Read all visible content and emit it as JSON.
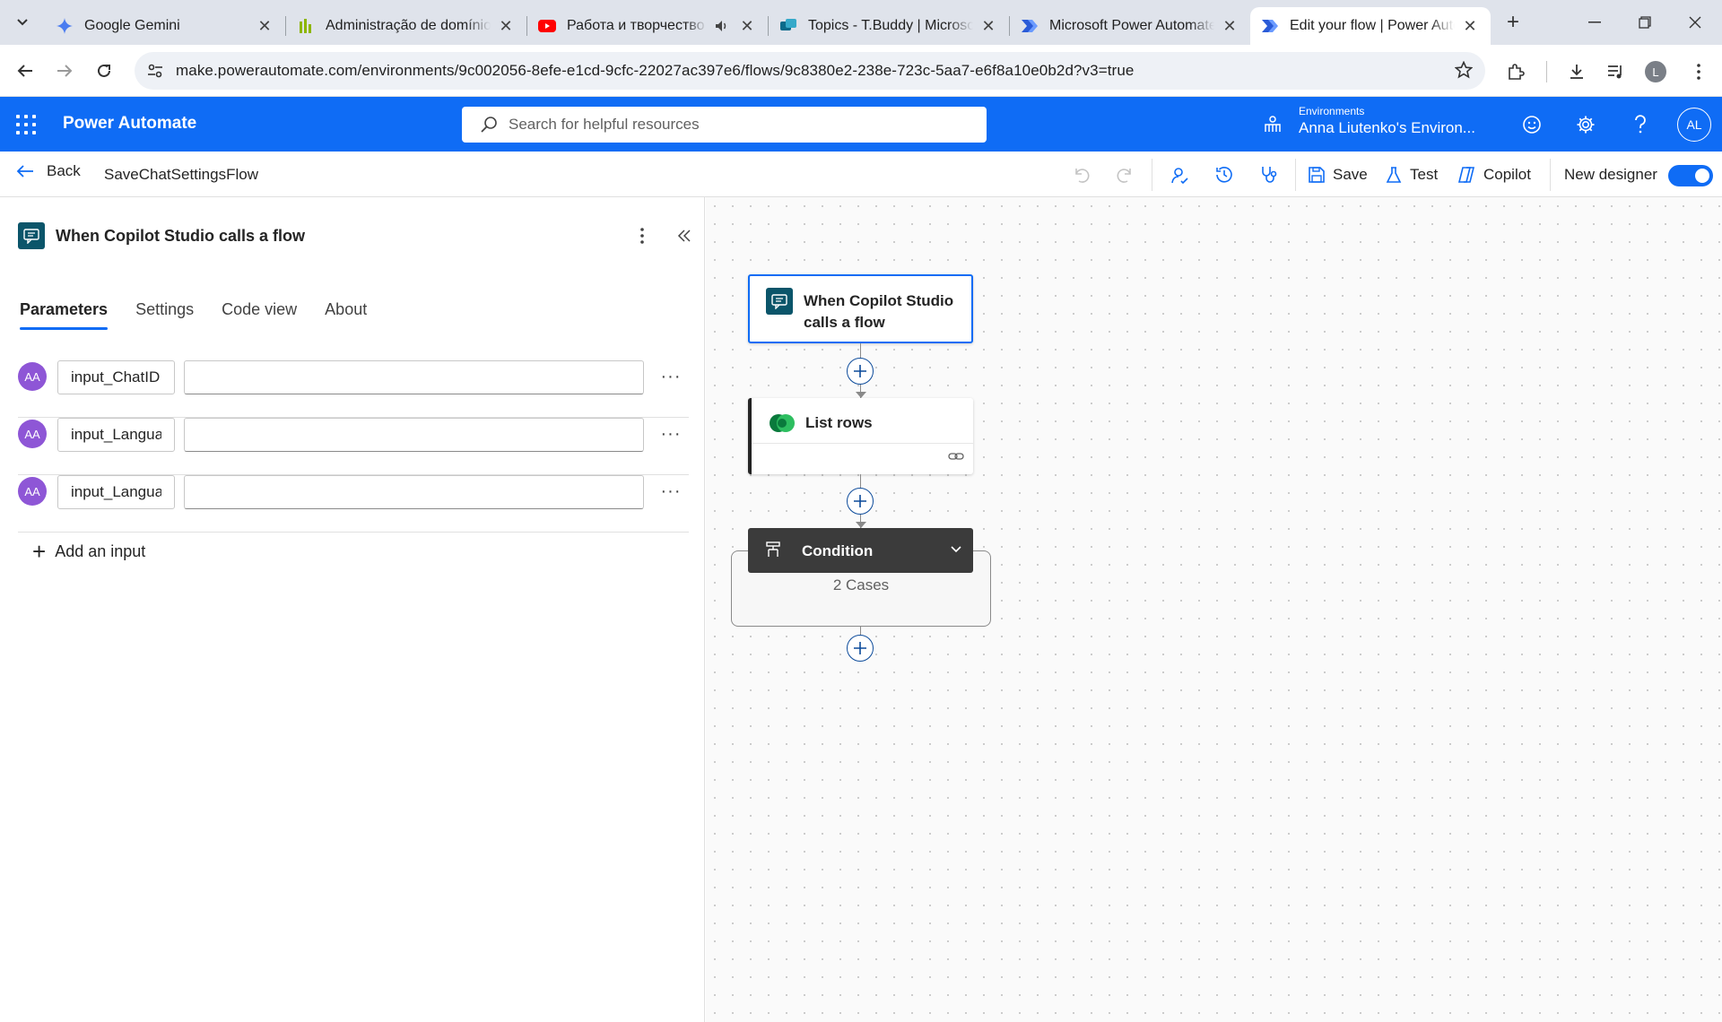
{
  "browser": {
    "tabs": [
      {
        "title": "Google Gemini",
        "icon": "gemini-icon"
      },
      {
        "title": "Administração de domínio",
        "icon": "domain-admin-icon"
      },
      {
        "title": "Работа и творчество",
        "icon": "youtube-icon"
      },
      {
        "title": "Topics - T.Buddy | Microsoft",
        "icon": "copilot-studio-icon"
      },
      {
        "title": "Microsoft Power Automate",
        "icon": "power-automate-icon"
      },
      {
        "title": "Edit your flow | Power Automate",
        "icon": "power-automate-icon"
      }
    ],
    "active_tab_index": 5,
    "url": "make.powerautomate.com/environments/9c002056-8efe-e1cd-9cfc-22027ac397e6/flows/9c8380e2-238e-723c-5aa7-e6f8a10e0b2d?v3=true",
    "profile_initial": "L"
  },
  "header": {
    "app_title": "Power Automate",
    "search_placeholder": "Search for helpful resources",
    "environment_label": "Environments",
    "environment_name": "Anna Liutenko's Environ...",
    "avatar_initials": "AL",
    "accent_color": "#0f6cf5"
  },
  "commandbar": {
    "back_label": "Back",
    "flow_name": "SaveChatSettingsFlow",
    "save_label": "Save",
    "test_label": "Test",
    "copilot_label": "Copilot",
    "new_designer_label": "New designer",
    "new_designer_on": true
  },
  "panel": {
    "title": "When Copilot Studio calls a flow",
    "tabs": [
      "Parameters",
      "Settings",
      "Code view",
      "About"
    ],
    "active_tab": "Parameters",
    "params": [
      {
        "type_badge": "AA",
        "name": "input_ChatID",
        "value": ""
      },
      {
        "type_badge": "AA",
        "name": "input_Langua",
        "value": ""
      },
      {
        "type_badge": "AA",
        "name": "input_Langua",
        "value": ""
      }
    ],
    "add_input_label": "Add an input"
  },
  "canvas": {
    "trigger_title": "When Copilot Studio calls a flow",
    "list_rows_title": "List rows",
    "condition_title": "Condition",
    "condition_cases": "2 Cases"
  }
}
